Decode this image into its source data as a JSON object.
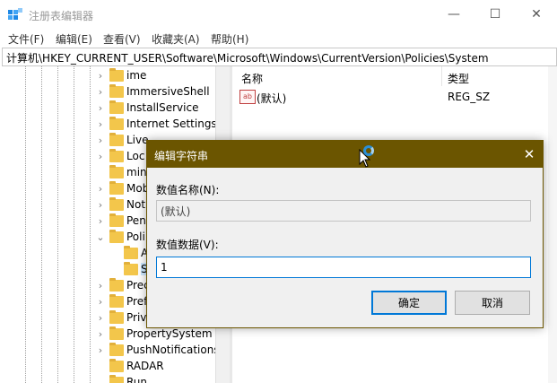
{
  "window": {
    "title": "注册表编辑器",
    "minimize_glyph": "—",
    "maximize_glyph": "☐",
    "close_glyph": "✕"
  },
  "menu": [
    "文件(F)",
    "编辑(E)",
    "查看(V)",
    "收藏夹(A)",
    "帮助(H)"
  ],
  "address": "计算机\\HKEY_CURRENT_USER\\Software\\Microsoft\\Windows\\CurrentVersion\\Policies\\System",
  "tree": [
    {
      "label": "ime",
      "chev": "›"
    },
    {
      "label": "ImmersiveShell",
      "chev": "›"
    },
    {
      "label": "InstallService",
      "chev": "›"
    },
    {
      "label": "Internet Settings",
      "chev": "›"
    },
    {
      "label": "Live",
      "chev": "›"
    },
    {
      "label": "Loc",
      "chev": "›"
    },
    {
      "label": "min",
      "chev": ""
    },
    {
      "label": "Mob",
      "chev": "›"
    },
    {
      "label": "Noti",
      "chev": "›"
    },
    {
      "label": "Pen",
      "chev": "›"
    },
    {
      "label": "Poli",
      "chev": "⌄"
    },
    {
      "label": "A",
      "chev": ""
    },
    {
      "label": "S",
      "chev": "",
      "selected": true
    },
    {
      "label": "Prec",
      "chev": "›"
    },
    {
      "label": "Pref",
      "chev": "›"
    },
    {
      "label": "Priv",
      "chev": "›"
    },
    {
      "label": "PropertySystem",
      "chev": "›"
    },
    {
      "label": "PushNotifications",
      "chev": "›"
    },
    {
      "label": "RADAR",
      "chev": ""
    },
    {
      "label": "Run",
      "chev": ""
    }
  ],
  "list": {
    "headers": {
      "name": "名称",
      "type": "类型"
    },
    "rows": [
      {
        "icon": "ab",
        "name": "(默认)",
        "type": "REG_SZ"
      }
    ]
  },
  "dialog": {
    "title": "编辑字符串",
    "close_glyph": "✕",
    "name_label": "数值名称(N):",
    "name_value": "(默认)",
    "data_label": "数值数据(V):",
    "data_value": "1",
    "ok_label": "确定",
    "cancel_label": "取消"
  },
  "colors": {
    "dialog_title_bg": "#6b5500",
    "accent": "#0078d7",
    "folder": "#f3c64b"
  }
}
